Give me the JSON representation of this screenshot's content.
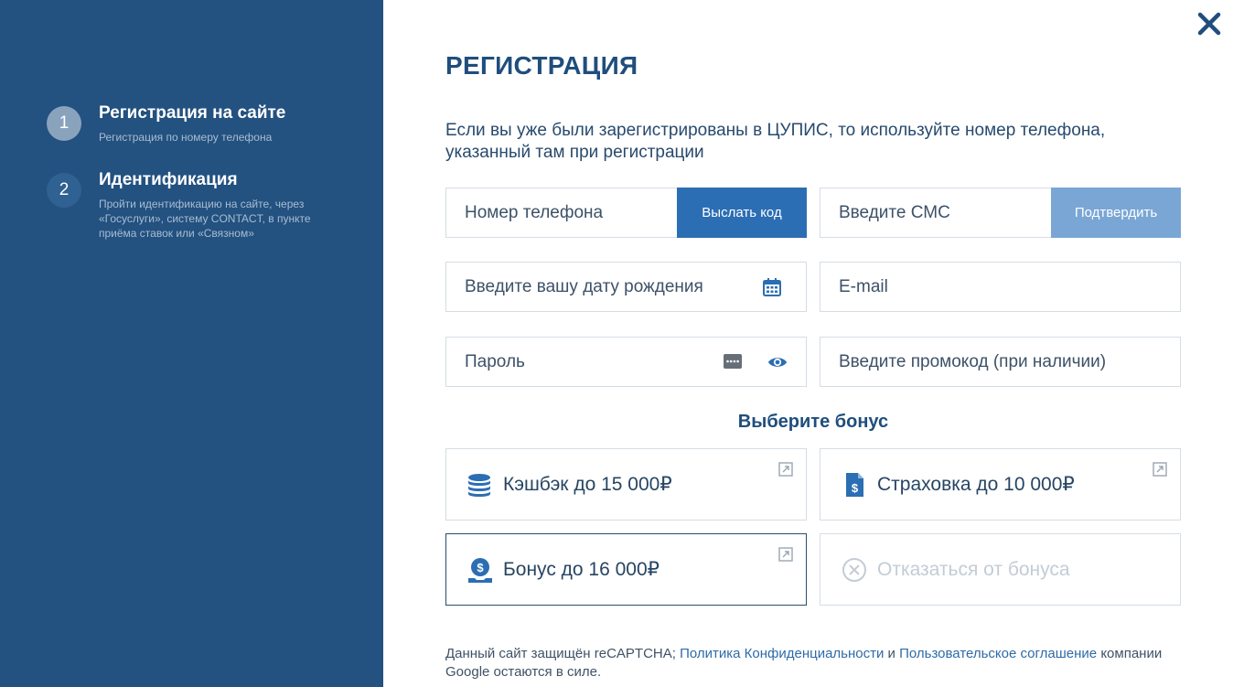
{
  "sidebar": {
    "steps": [
      {
        "number": "1",
        "title": "Регистрация на сайте",
        "description": "Регистрация по номеру телефона"
      },
      {
        "number": "2",
        "title": "Идентификация",
        "description": "Пройти идентификацию на сайте, через «Госуслуги», систему CONTACT, в пункте приёма ставок или «Связном»"
      }
    ]
  },
  "main": {
    "title": "РЕГИСТРАЦИЯ",
    "info": "Если вы уже были зарегистрированы в ЦУПИС, то используйте номер телефона, указанный там при регистрации",
    "phone_placeholder": "Номер телефона",
    "send_code_label": "Выслать код",
    "sms_placeholder": "Введите СМС",
    "confirm_label": "Подтвердить",
    "birthdate_placeholder": "Введите вашу дату рождения",
    "email_placeholder": "E-mail",
    "password_placeholder": "Пароль",
    "promo_placeholder": "Введите промокод (при наличии)",
    "bonus_heading": "Выберите бонус",
    "bonuses": [
      {
        "label": "Кэшбэк до 15 000₽",
        "icon": "coins-icon",
        "selected": false
      },
      {
        "label": "Страховка до 10 000₽",
        "icon": "insurance-document-icon",
        "selected": false
      },
      {
        "label": "Бонус до 16 000₽",
        "icon": "money-bag-icon",
        "selected": true
      },
      {
        "label": "Отказаться от бонуса",
        "icon": "cancel-circle-icon",
        "selected": false
      }
    ],
    "footer": {
      "text1": "Данный сайт защищён reCAPTCHA; ",
      "privacy_link": "Политика Конфиденциальности",
      "and": " и ",
      "terms_link": "Пользовательское соглашение",
      "text2": " компании Google остаются в силе."
    }
  },
  "colors": {
    "sidebar_bg": "#235180",
    "primary_button": "#2c6eb3",
    "secondary_button": "#7aa6d5",
    "heading": "#1f4e7d"
  }
}
